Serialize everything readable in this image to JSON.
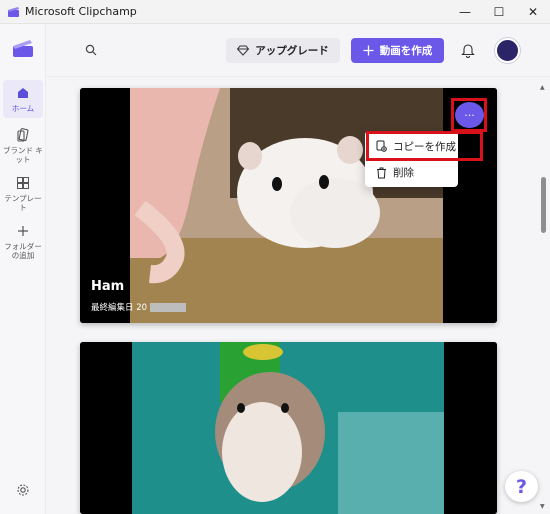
{
  "window": {
    "title": "Microsoft Clipchamp",
    "minimize": "—",
    "maximize": "☐",
    "close": "✕"
  },
  "sidebar": {
    "items": [
      {
        "label": "ホーム",
        "icon": "home-icon",
        "active": true
      },
      {
        "label": "ブランド キット",
        "icon": "brand-kit-icon"
      },
      {
        "label": "テンプレート",
        "icon": "templates-icon"
      },
      {
        "label": "フォルダーの追加",
        "icon": "add-folder-icon"
      }
    ],
    "settings_icon": "gear-icon"
  },
  "topbar": {
    "upgrade_label": "アップグレード",
    "create_label": "動画を作成"
  },
  "cards": [
    {
      "title": "Ham",
      "subtitle": "最終編集日 20"
    },
    {
      "title": "",
      "subtitle": ""
    }
  ],
  "context_menu": {
    "more_label": "···",
    "items": [
      {
        "label": "コピーを作成",
        "icon": "copy-icon"
      },
      {
        "label": "削除",
        "icon": "trash-icon"
      }
    ]
  },
  "help_label": "?",
  "colors": {
    "accent": "#6b57e8",
    "highlight": "#d8111b"
  }
}
